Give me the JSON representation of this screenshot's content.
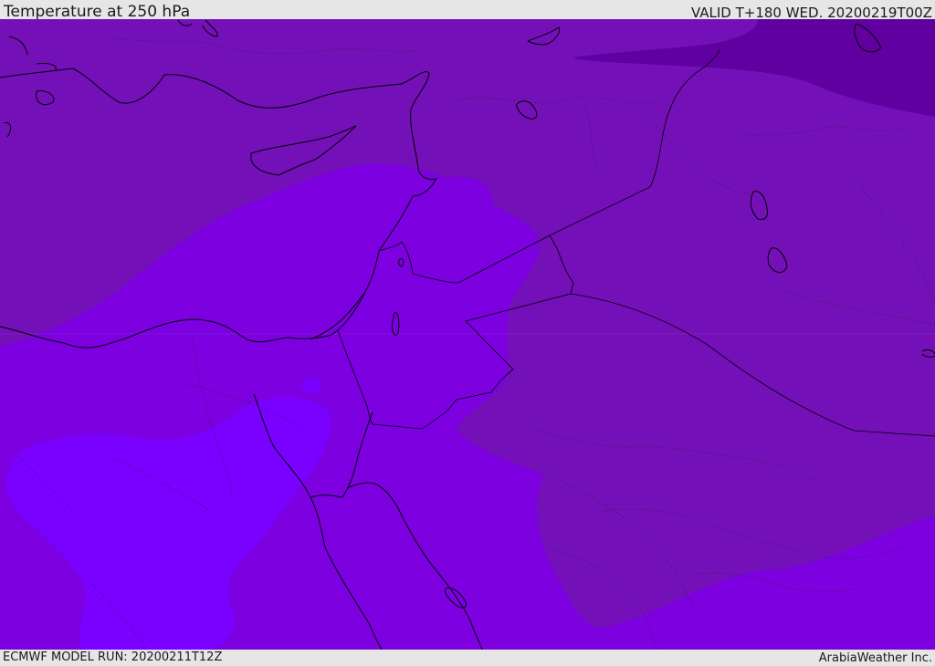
{
  "header": {
    "title": "Temperature at 250 hPa",
    "valid_time": "VALID T+180 WED. 20200219T00Z"
  },
  "footer": {
    "model_run": "ECMWF MODEL RUN: 20200211T12Z",
    "credit": "ArabiaWeather Inc."
  },
  "colors": {
    "band_coldest": "#6000a0",
    "band_cold": "#6a06a8",
    "band_cool": "#7410b8",
    "band_mid": "#7c00e0",
    "band_warm": "#7a00ff",
    "outline": "#000000",
    "frame": "#e6e6e6"
  }
}
